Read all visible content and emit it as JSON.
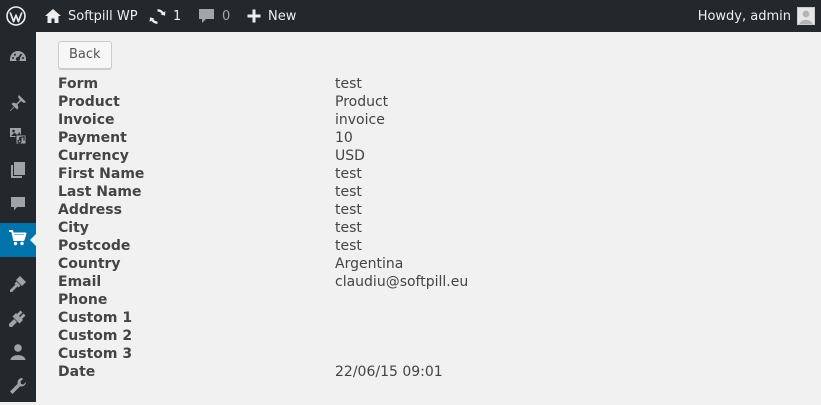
{
  "admin_bar": {
    "site_name": "Softpill WP",
    "updates_count": "1",
    "comments_count": "0",
    "new_label": "New",
    "howdy": "Howdy, admin"
  },
  "side_menu": {
    "items": [
      {
        "name": "dashboard",
        "icon": "dashboard-icon"
      },
      {
        "name": "posts",
        "icon": "pin-icon"
      },
      {
        "name": "media",
        "icon": "media-icon"
      },
      {
        "name": "pages",
        "icon": "pages-icon"
      },
      {
        "name": "comments",
        "icon": "comment-icon"
      },
      {
        "name": "softpill-payments",
        "icon": "cart-icon",
        "current": true
      },
      {
        "name": "appearance",
        "icon": "brush-icon"
      },
      {
        "name": "plugins",
        "icon": "plugin-icon"
      },
      {
        "name": "users",
        "icon": "user-icon"
      },
      {
        "name": "tools",
        "icon": "wrench-icon"
      }
    ],
    "accent_color": "#0073aa"
  },
  "page": {
    "back_label": "Back"
  },
  "details": [
    {
      "label": "Form",
      "value": "test"
    },
    {
      "label": "Product",
      "value": "Product"
    },
    {
      "label": "Invoice",
      "value": "invoice"
    },
    {
      "label": "Payment",
      "value": "10"
    },
    {
      "label": "Currency",
      "value": "USD"
    },
    {
      "label": "First Name",
      "value": "test"
    },
    {
      "label": "Last Name",
      "value": "test"
    },
    {
      "label": "Address",
      "value": "test"
    },
    {
      "label": "City",
      "value": "test"
    },
    {
      "label": "Postcode",
      "value": "test"
    },
    {
      "label": "Country",
      "value": "Argentina"
    },
    {
      "label": "Email",
      "value": "claudiu@softpill.eu"
    },
    {
      "label": "Phone",
      "value": ""
    },
    {
      "label": "Custom 1",
      "value": ""
    },
    {
      "label": "Custom 2",
      "value": ""
    },
    {
      "label": "Custom 3",
      "value": ""
    },
    {
      "label": "Date",
      "value": "22/06/15 09:01"
    }
  ]
}
